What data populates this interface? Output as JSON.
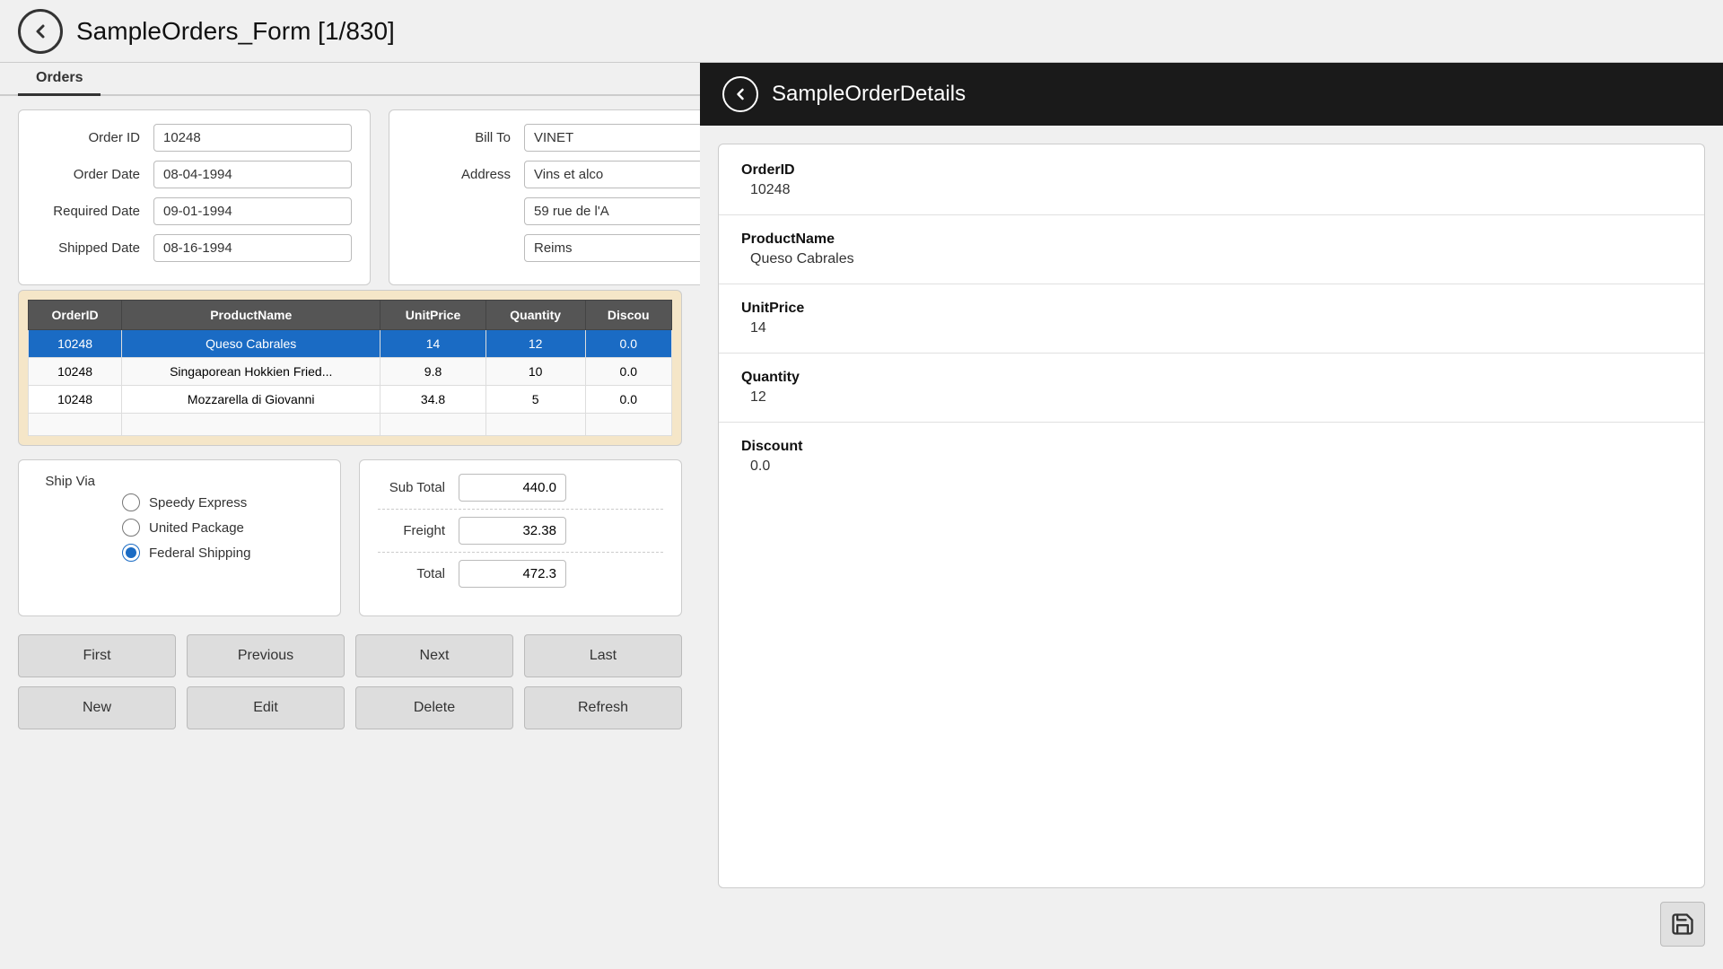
{
  "header": {
    "title": "SampleOrders_Form [1/830]",
    "back_icon": "←"
  },
  "tabs": [
    {
      "label": "Orders",
      "active": true
    }
  ],
  "form": {
    "order_id_label": "Order ID",
    "order_id_value": "10248",
    "order_date_label": "Order Date",
    "order_date_value": "08-04-1994",
    "required_date_label": "Required Date",
    "required_date_value": "09-01-1994",
    "shipped_date_label": "Shipped Date",
    "shipped_date_value": "08-16-1994",
    "bill_to_label": "Bill To",
    "bill_to_value": "VINET",
    "address_label": "Address",
    "address_value": "Vins et alco",
    "address2_value": "59 rue de l'A",
    "city_value": "Reims"
  },
  "table": {
    "columns": [
      "OrderID",
      "ProductName",
      "UnitPrice",
      "Quantity",
      "Discou"
    ],
    "rows": [
      {
        "order_id": "10248",
        "product_name": "Queso Cabrales",
        "unit_price": "14",
        "quantity": "12",
        "discount": "0.0",
        "selected": true
      },
      {
        "order_id": "10248",
        "product_name": "Singaporean Hokkien Fried...",
        "unit_price": "9.8",
        "quantity": "10",
        "discount": "0.0",
        "selected": false
      },
      {
        "order_id": "10248",
        "product_name": "Mozzarella di Giovanni",
        "unit_price": "34.8",
        "quantity": "5",
        "discount": "0.0",
        "selected": false
      }
    ]
  },
  "ship_via": {
    "label": "Ship Via",
    "options": [
      {
        "value": "speedy",
        "label": "Speedy Express",
        "checked": false
      },
      {
        "value": "united",
        "label": "United Package",
        "checked": false
      },
      {
        "value": "federal",
        "label": "Federal Shipping",
        "checked": true
      }
    ]
  },
  "totals": {
    "sub_total_label": "Sub Total",
    "sub_total_value": "440.0",
    "freight_label": "Freight",
    "freight_value": "32.38",
    "total_label": "Total",
    "total_value": "472.3"
  },
  "nav_buttons": {
    "row1": [
      {
        "id": "first-button",
        "label": "First"
      },
      {
        "id": "previous-button",
        "label": "Previous"
      },
      {
        "id": "next-button",
        "label": "Next"
      },
      {
        "id": "last-button",
        "label": "Last"
      }
    ],
    "row2": [
      {
        "id": "new-button",
        "label": "New"
      },
      {
        "id": "edit-button",
        "label": "Edit"
      },
      {
        "id": "delete-button",
        "label": "Delete"
      },
      {
        "id": "refresh-button",
        "label": "Refresh"
      }
    ]
  },
  "right_panel": {
    "title": "SampleOrderDetails",
    "back_icon": "←",
    "detail": {
      "order_id_label": "OrderID",
      "order_id_value": "10248",
      "product_name_label": "ProductName",
      "product_name_value": "Queso Cabrales",
      "unit_price_label": "UnitPrice",
      "unit_price_value": "14",
      "quantity_label": "Quantity",
      "quantity_value": "12",
      "discount_label": "Discount",
      "discount_value": "0.0"
    },
    "save_icon": "💾"
  }
}
